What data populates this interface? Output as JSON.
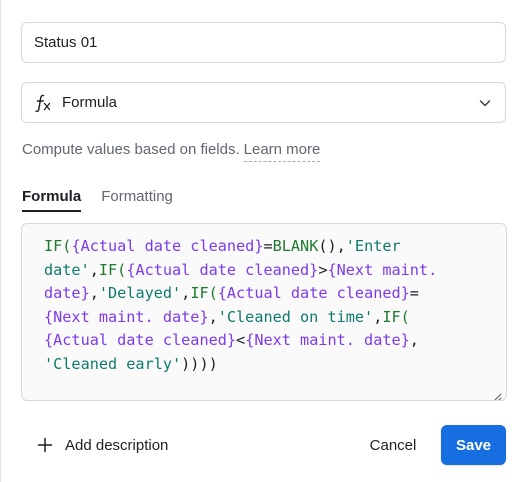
{
  "field": {
    "name_value": "Status 01",
    "type_label": "Formula",
    "type_icon": "fx-icon"
  },
  "description": {
    "text": "Compute values based on fields.",
    "learn_more": "Learn more"
  },
  "tabs": [
    {
      "label": "Formula",
      "active": true
    },
    {
      "label": "Formatting",
      "active": false
    }
  ],
  "formula": {
    "line1_a": "IF(",
    "line1_b": "{Actual date cleaned}",
    "line1_c": "=",
    "line1_d": "BLANK",
    "line1_e": "(),",
    "line1_f": "'Enter",
    "line2_a": "date'",
    "line2_b": ",",
    "line2_c": "IF(",
    "line2_d": "{Actual date cleaned}",
    "line2_e": ">",
    "line2_f": "{Next maint.",
    "line3_a": "date}",
    "line3_b": ",",
    "line3_c": "'Delayed'",
    "line3_d": ",",
    "line3_e": "IF(",
    "line3_f": "{Actual date cleaned}",
    "line3_g": "=",
    "line4_a": "{Next maint. date}",
    "line4_b": ",",
    "line4_c": "'Cleaned on time'",
    "line4_d": ",",
    "line4_e": "IF(",
    "line5_a": "{Actual date cleaned}",
    "line5_b": "<",
    "line5_c": "{Next maint. date}",
    "line5_d": ",",
    "line6_a": "'Cleaned early'",
    "line6_b": "))))"
  },
  "footer": {
    "add_description": "Add description",
    "cancel": "Cancel",
    "save": "Save"
  },
  "colors": {
    "accent": "#166ee1",
    "function": "#1f7a2e",
    "field_ref": "#7c3aed",
    "string": "#0f7a6c"
  }
}
